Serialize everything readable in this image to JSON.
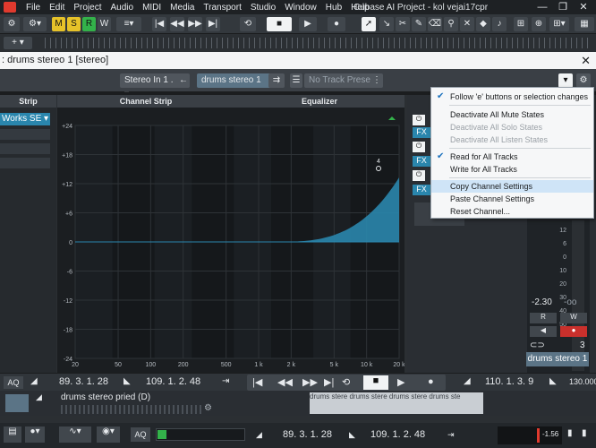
{
  "menubar": {
    "items": [
      "File",
      "Edit",
      "Project",
      "Audio",
      "MIDI",
      "Media",
      "Transport",
      "Studio",
      "Window",
      "Hub",
      "Help"
    ],
    "title": "Cubase AI Project - kol vejai17cpr",
    "min": "—",
    "restore": "❐",
    "close": "✕"
  },
  "toolbar": {
    "m": "M",
    "s": "S",
    "r": "R",
    "w": "W"
  },
  "dialog": {
    "title": ": drums stereo 1 [stereo]"
  },
  "chbar": {
    "input": "Stereo In 1 .",
    "channel": "drums stereo 1",
    "preset_placeholder": "No Track Preset"
  },
  "panels": {
    "strip": "Strip",
    "channel_strip": "Channel Strip",
    "equalizer": "Equalizer",
    "strip_item": "Works SE"
  },
  "eq": {
    "y_ticks": [
      "+24",
      "+18",
      "+12",
      "+6",
      "0",
      "-6",
      "-12",
      "-18",
      "-24"
    ],
    "x_ticks": [
      "20",
      "50",
      "100",
      "200",
      "500",
      "1 k",
      "2 k",
      "5 k",
      "10 k",
      "20 k"
    ],
    "band_label": "4"
  },
  "right": {
    "fx": [
      "FX",
      "FX",
      "FX",
      "FX"
    ],
    "scale": [
      "12",
      "6",
      "0",
      "10",
      "20",
      "30",
      "40",
      "50"
    ],
    "volume": "-2.30",
    "peak": "-oo",
    "r": "R",
    "w": "W",
    "num": "3",
    "channel_name": "drums stereo 1"
  },
  "transport": {
    "aq": "AQ",
    "pos1": "89. 3. 1. 28",
    "pos2": "109. 1. 2. 48",
    "pos3": "110. 1. 3. 9",
    "tempo": "130.000"
  },
  "track": {
    "name": "drums stereo pried  (D)",
    "clip": "drums stere drums stere drums stere drums ste"
  },
  "bottom": {
    "aq": "AQ",
    "pos1": "89. 3. 1. 28",
    "pos2": "109. 1. 2. 48",
    "level": "-1.56"
  },
  "context_menu": {
    "items": [
      {
        "label": "Follow 'e' buttons or selection changes",
        "checked": true,
        "disabled": false
      },
      {
        "label": "Deactivate All Mute States",
        "checked": false,
        "disabled": false
      },
      {
        "label": "Deactivate All Solo States",
        "checked": false,
        "disabled": true
      },
      {
        "label": "Deactivate All Listen States",
        "checked": false,
        "disabled": true
      },
      {
        "label": "Read for All Tracks",
        "checked": true,
        "disabled": false
      },
      {
        "label": "Write for All Tracks",
        "checked": false,
        "disabled": false
      },
      {
        "label": "Copy Channel Settings",
        "checked": false,
        "disabled": false
      },
      {
        "label": "Paste Channel Settings",
        "checked": false,
        "disabled": false
      },
      {
        "label": "Reset Channel...",
        "checked": false,
        "disabled": false
      }
    ]
  },
  "colors": {
    "accent": "#2a8fb8",
    "eq_fill": "#2a86ad",
    "menu_highlight": "#cfe4f7"
  }
}
